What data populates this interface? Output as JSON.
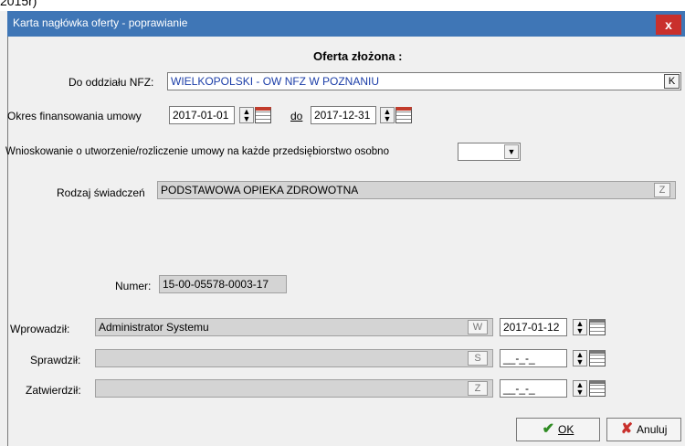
{
  "header_fragment": "2015r)",
  "window": {
    "title": "Karta nagłówka oferty - poprawianie",
    "close_label": "x"
  },
  "heading": "Oferta złożona :",
  "nfz": {
    "label": "Do oddziału NFZ:",
    "value": "WIELKOPOLSKI  -  OW NFZ W POZNANIU",
    "button": "K"
  },
  "okres": {
    "label": "Okres finansowania umowy",
    "from": "2017-01-01",
    "to_label": "do",
    "to": "2017-12-31"
  },
  "wniosek": {
    "label": "Wnioskowanie o utworzenie/rozliczenie umowy na każde przedsiębiorstwo osobno",
    "value": ""
  },
  "rodzaj": {
    "label": "Rodzaj świadczeń",
    "value": "PODSTAWOWA OPIEKA ZDROWOTNA",
    "button": "Z"
  },
  "numer": {
    "label": "Numer:",
    "value": "15-00-05578-0003-17"
  },
  "wprowadzil": {
    "label": "Wprowadził:",
    "value": "Administrator Systemu",
    "button": "W",
    "date": "2017-01-12"
  },
  "sprawdzil": {
    "label": "Sprawdził:",
    "value": "",
    "button": "S",
    "date": "__-_-_"
  },
  "zatwierdzil": {
    "label": "Zatwierdził:",
    "value": "",
    "button": "Z",
    "date": "__-_-_"
  },
  "buttons": {
    "ok": "OK",
    "cancel": "Anuluj"
  },
  "colors": {
    "titlebar": "#3f76b6",
    "close": "#c9302c",
    "field_text": "#1c3ea8"
  }
}
